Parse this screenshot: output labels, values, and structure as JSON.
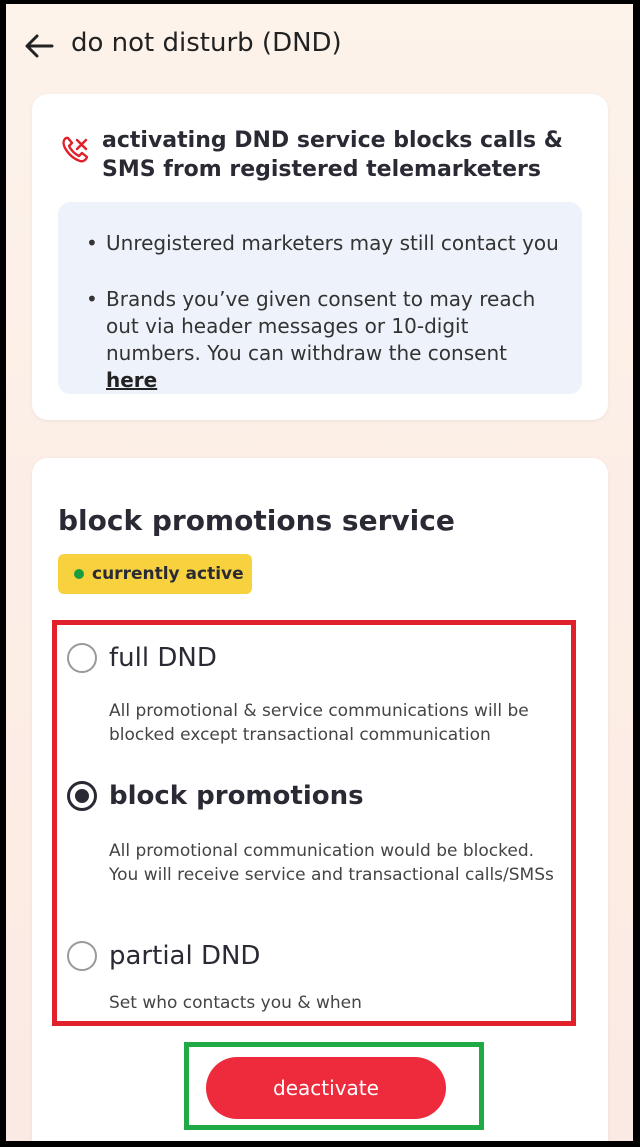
{
  "header": {
    "title": "do not disturb (DND)",
    "back_icon": "arrow-left-icon"
  },
  "info_card": {
    "icon": "blocked-call-icon",
    "title": "activating DND service blocks calls & SMS from registered telemarketers",
    "bullets": [
      "Unregistered marketers may still contact you",
      "Brands you’ve given consent to may reach out via header messages or 10-digit numbers. You can withdraw the consent"
    ],
    "link_label": "here"
  },
  "service_card": {
    "title": "block promotions service",
    "status": "currently active",
    "options": [
      {
        "label": "full DND",
        "description": "All promotional & service communications will be blocked except transactional communication",
        "selected": false
      },
      {
        "label": "block promotions",
        "description": "All promotional communication would be blocked. You will receive service and transactional calls/SMSs",
        "selected": true
      },
      {
        "label": "partial DND",
        "description": "Set who contacts you & when",
        "selected": false
      }
    ]
  },
  "actions": {
    "deactivate_label": "deactivate"
  },
  "colors": {
    "accent_red": "#ee2b3d",
    "badge_yellow": "#f7d23e",
    "status_green": "#1a9d3e",
    "highlight_red_border": "#e0202b",
    "highlight_green_border": "#1faa45"
  }
}
